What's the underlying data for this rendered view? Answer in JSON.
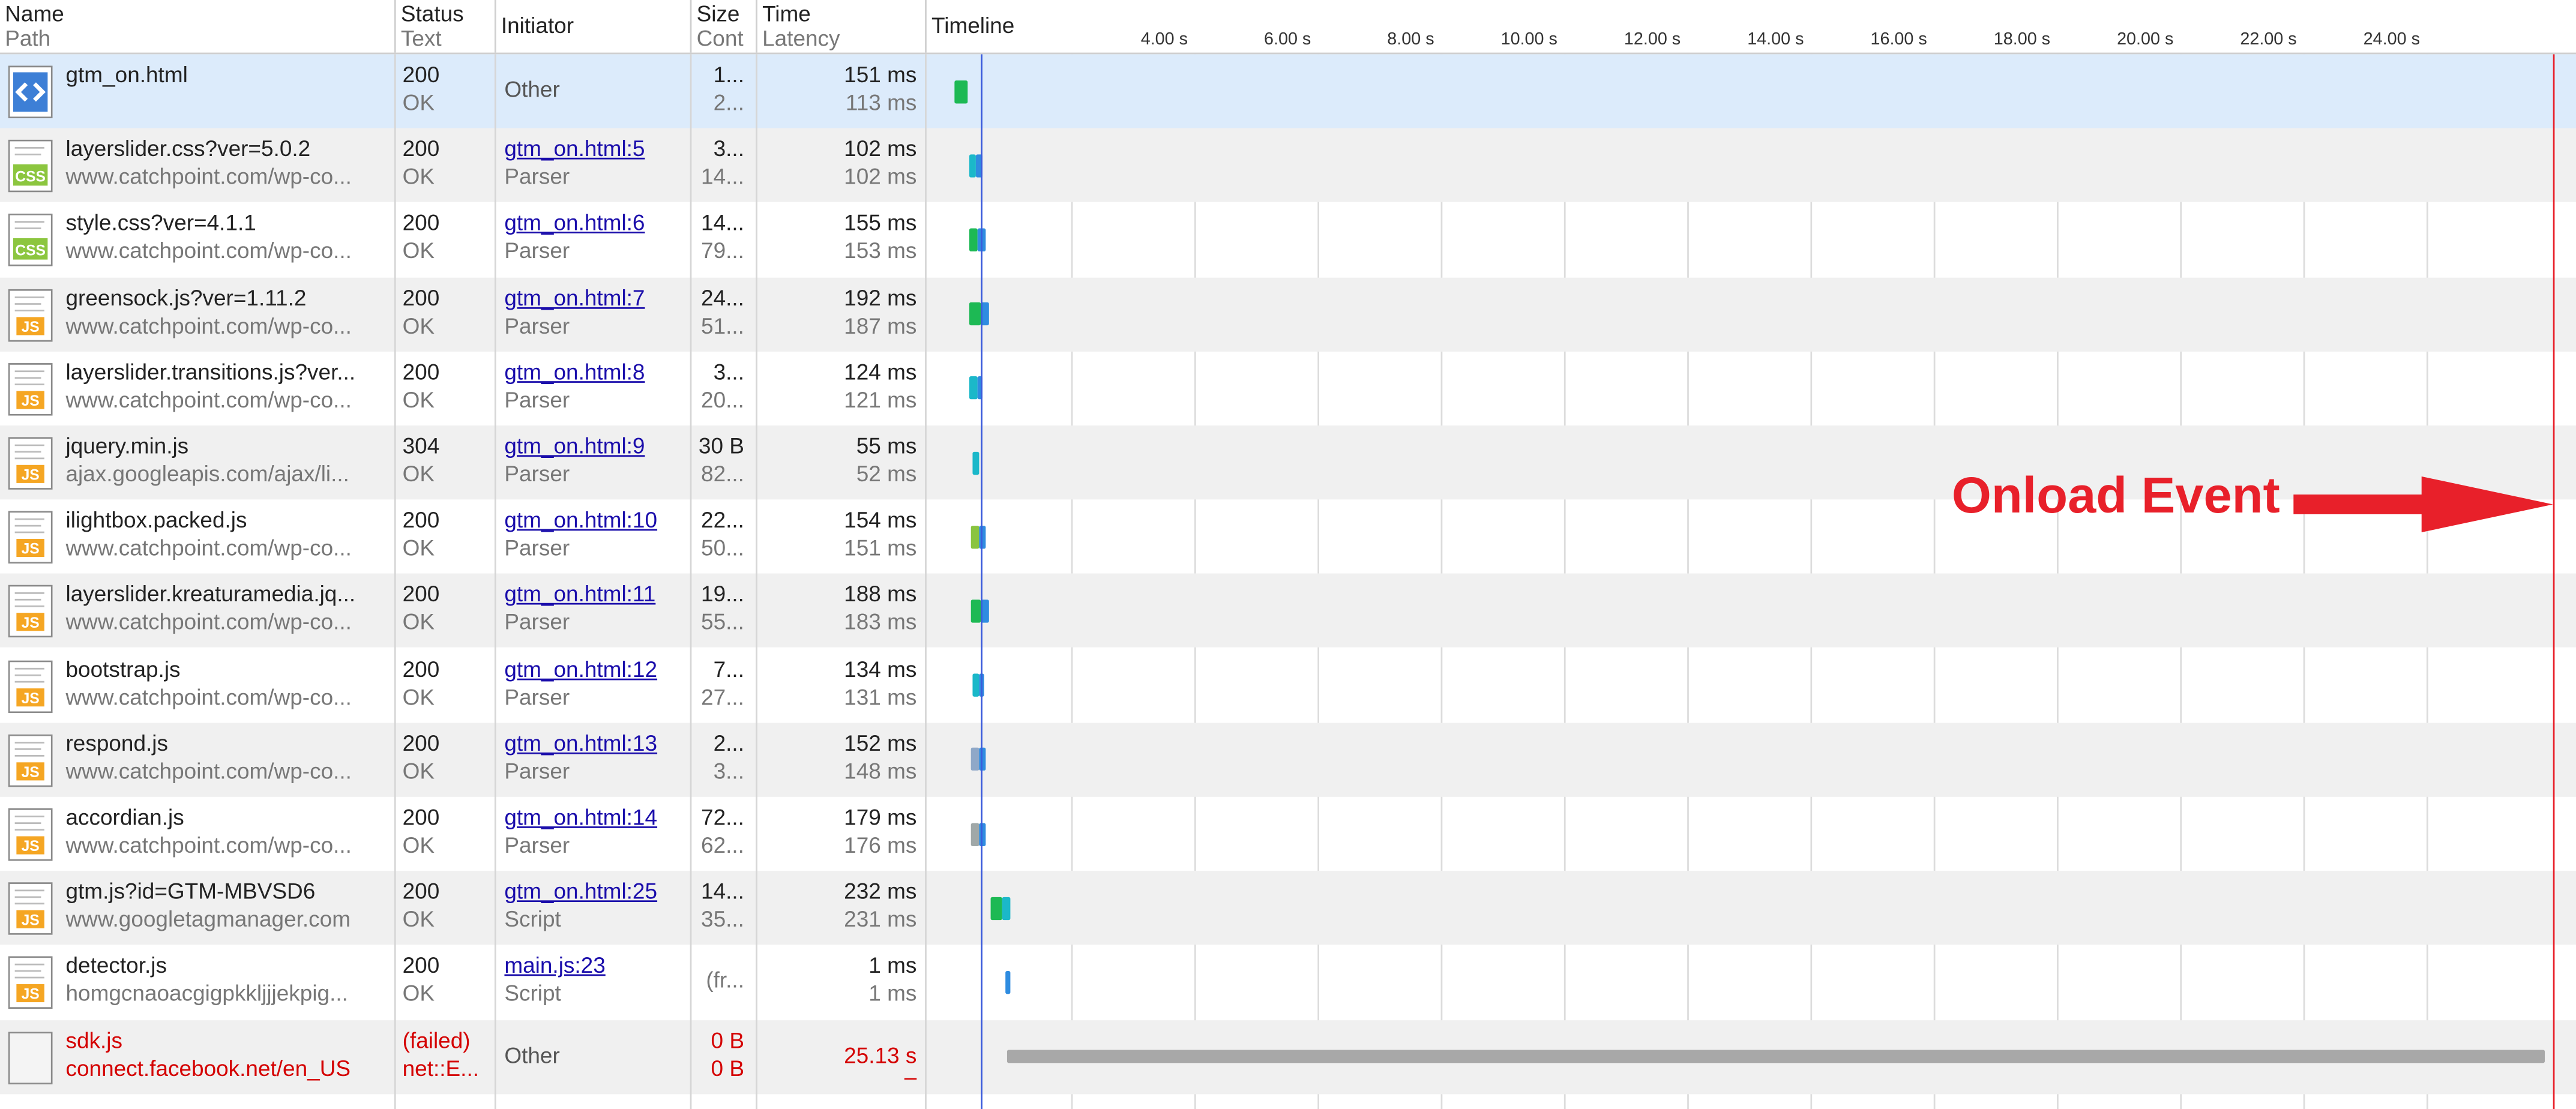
{
  "columns": {
    "name": "Name",
    "path": "Path",
    "status": "Status",
    "status_text": "Text",
    "initiator": "Initiator",
    "size": "Size",
    "content": "Cont",
    "time": "Time",
    "latency": "Latency",
    "timeline": "Timeline"
  },
  "timeline_ticks": [
    "4.00 s",
    "6.00 s",
    "8.00 s",
    "10.00 s",
    "12.00 s",
    "14.00 s",
    "16.00 s",
    "18.00 s",
    "20.00 s",
    "22.00 s",
    "24.00 s"
  ],
  "annotation": {
    "label": "Onload Event",
    "color": "#e8202a"
  },
  "colors": {
    "selected_row": "#dcebfb",
    "alt_row": "#f0f0f0",
    "error_text": "#d40000",
    "link": "#1a0dab",
    "dom_line": "#3b5bdb",
    "onload_line": "#e8202a"
  },
  "rows": [
    {
      "icon": "html",
      "name": "gtm_on.html",
      "path": "",
      "status": "200",
      "status_text": "OK",
      "initiator": "Other",
      "initiator_link": false,
      "initiator_type": "",
      "size": "1...",
      "content": "2...",
      "time": "151 ms",
      "latency": "113 ms",
      "selected": true
    },
    {
      "icon": "css",
      "name": "layerslider.css?ver=5.0.2",
      "path": "www.catchpoint.com/wp-co...",
      "status": "200",
      "status_text": "OK",
      "initiator": "gtm_on.html:5",
      "initiator_link": true,
      "initiator_type": "Parser",
      "size": "3...",
      "content": "14...",
      "time": "102 ms",
      "latency": "102 ms"
    },
    {
      "icon": "css",
      "name": "style.css?ver=4.1.1",
      "path": "www.catchpoint.com/wp-co...",
      "status": "200",
      "status_text": "OK",
      "initiator": "gtm_on.html:6",
      "initiator_link": true,
      "initiator_type": "Parser",
      "size": "14...",
      "content": "79...",
      "time": "155 ms",
      "latency": "153 ms"
    },
    {
      "icon": "js",
      "name": "greensock.js?ver=1.11.2",
      "path": "www.catchpoint.com/wp-co...",
      "status": "200",
      "status_text": "OK",
      "initiator": "gtm_on.html:7",
      "initiator_link": true,
      "initiator_type": "Parser",
      "size": "24...",
      "content": "51...",
      "time": "192 ms",
      "latency": "187 ms"
    },
    {
      "icon": "js",
      "name": "layerslider.transitions.js?ver...",
      "path": "www.catchpoint.com/wp-co...",
      "status": "200",
      "status_text": "OK",
      "initiator": "gtm_on.html:8",
      "initiator_link": true,
      "initiator_type": "Parser",
      "size": "3...",
      "content": "20...",
      "time": "124 ms",
      "latency": "121 ms"
    },
    {
      "icon": "js",
      "name": "jquery.min.js",
      "path": "ajax.googleapis.com/ajax/li...",
      "status": "304",
      "status_text": "OK",
      "initiator": "gtm_on.html:9",
      "initiator_link": true,
      "initiator_type": "Parser",
      "size": "30 B",
      "content": "82...",
      "time": "55 ms",
      "latency": "52 ms"
    },
    {
      "icon": "js",
      "name": "ilightbox.packed.js",
      "path": "www.catchpoint.com/wp-co...",
      "status": "200",
      "status_text": "OK",
      "initiator": "gtm_on.html:10",
      "initiator_link": true,
      "initiator_type": "Parser",
      "size": "22...",
      "content": "50...",
      "time": "154 ms",
      "latency": "151 ms"
    },
    {
      "icon": "js",
      "name": "layerslider.kreaturamedia.jq...",
      "path": "www.catchpoint.com/wp-co...",
      "status": "200",
      "status_text": "OK",
      "initiator": "gtm_on.html:11",
      "initiator_link": true,
      "initiator_type": "Parser",
      "size": "19...",
      "content": "55...",
      "time": "188 ms",
      "latency": "183 ms"
    },
    {
      "icon": "js",
      "name": "bootstrap.js",
      "path": "www.catchpoint.com/wp-co...",
      "status": "200",
      "status_text": "OK",
      "initiator": "gtm_on.html:12",
      "initiator_link": true,
      "initiator_type": "Parser",
      "size": "7...",
      "content": "27...",
      "time": "134 ms",
      "latency": "131 ms"
    },
    {
      "icon": "js",
      "name": "respond.js",
      "path": "www.catchpoint.com/wp-co...",
      "status": "200",
      "status_text": "OK",
      "initiator": "gtm_on.html:13",
      "initiator_link": true,
      "initiator_type": "Parser",
      "size": "2...",
      "content": "3...",
      "time": "152 ms",
      "latency": "148 ms"
    },
    {
      "icon": "js",
      "name": "accordian.js",
      "path": "www.catchpoint.com/wp-co...",
      "status": "200",
      "status_text": "OK",
      "initiator": "gtm_on.html:14",
      "initiator_link": true,
      "initiator_type": "Parser",
      "size": "72...",
      "content": "62...",
      "time": "179 ms",
      "latency": "176 ms"
    },
    {
      "icon": "js",
      "name": "gtm.js?id=GTM-MBVSD6",
      "path": "www.googletagmanager.com",
      "status": "200",
      "status_text": "OK",
      "initiator": "gtm_on.html:25",
      "initiator_link": true,
      "initiator_type": "Script",
      "size": "14...",
      "content": "35...",
      "time": "232 ms",
      "latency": "231 ms"
    },
    {
      "icon": "js",
      "name": "detector.js",
      "path": "homgcnaoacgigpkkljjjekpig...",
      "status": "200",
      "status_text": "OK",
      "initiator": "main.js:23",
      "initiator_link": true,
      "initiator_type": "Script",
      "size": "(fr...",
      "content": "",
      "time": "1 ms",
      "latency": "1 ms",
      "grey_status": true
    },
    {
      "icon": "blank",
      "name": "sdk.js",
      "path": "connect.facebook.net/en_US",
      "status": "(failed)",
      "status_text": "net::E...",
      "initiator": "Other",
      "initiator_link": false,
      "initiator_type": "",
      "size": "0 B",
      "content": "0 B",
      "time": "25.13 s",
      "latency": "–",
      "failed": true
    }
  ]
}
